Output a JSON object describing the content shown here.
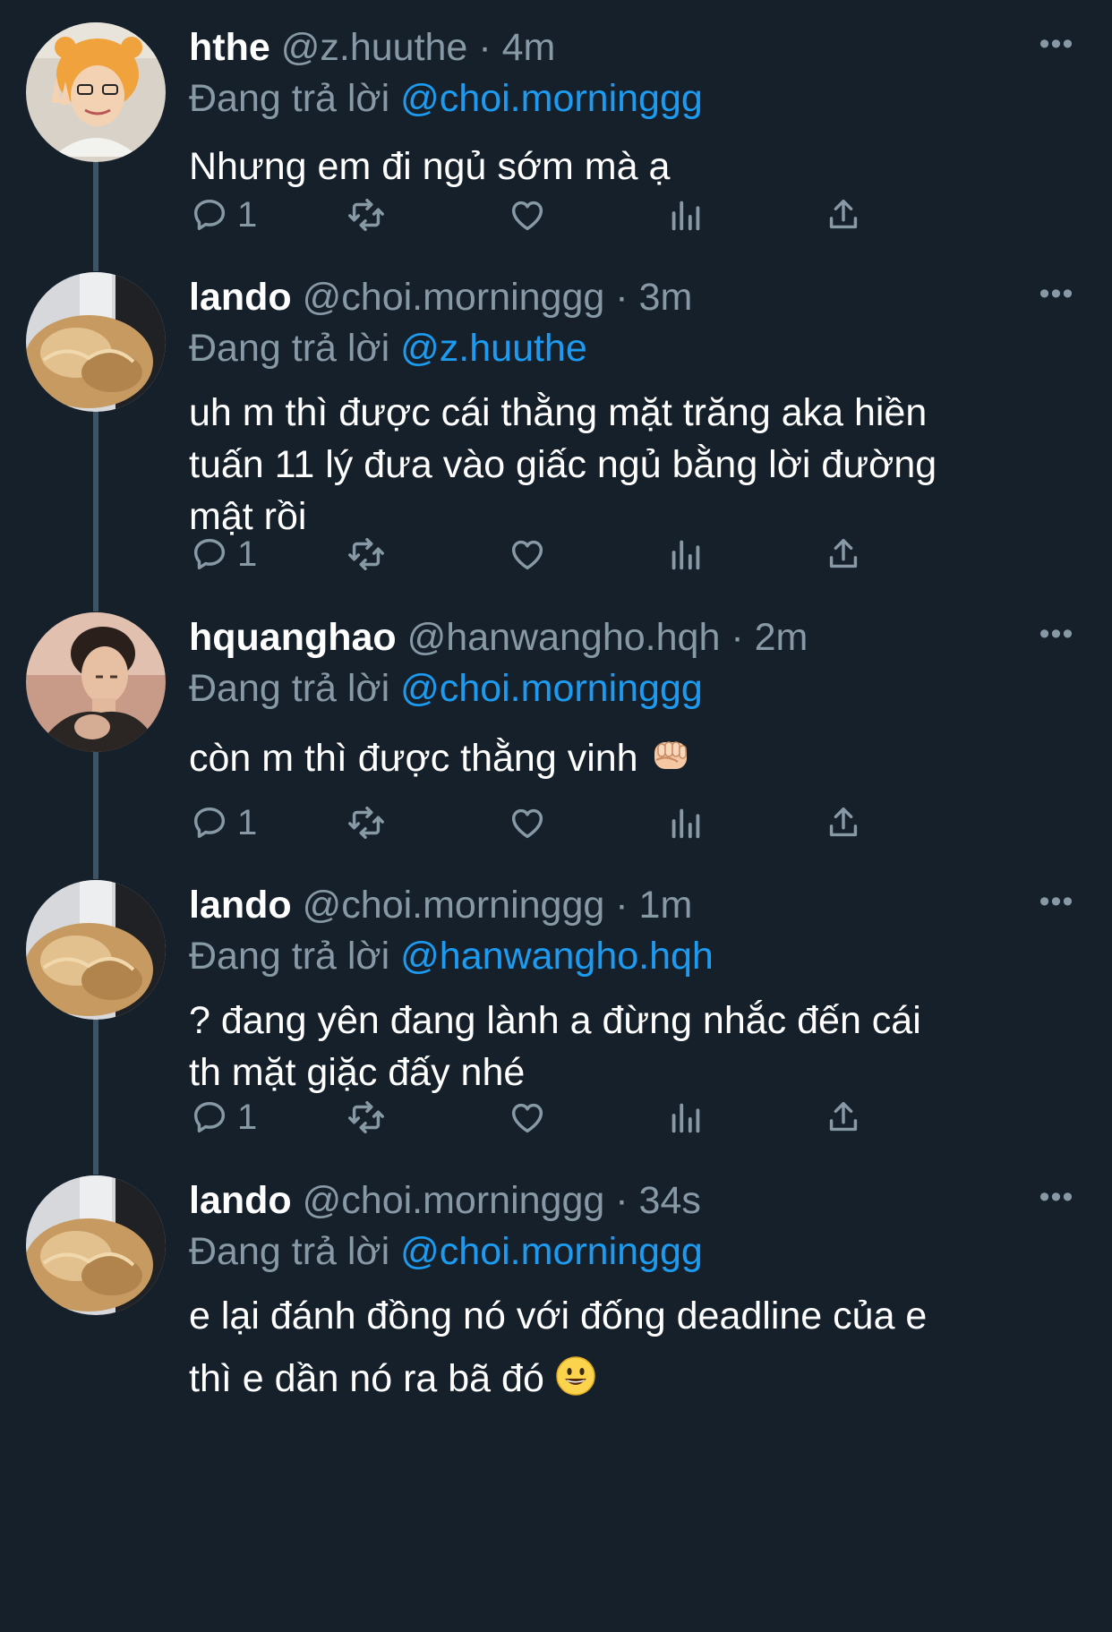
{
  "reply_prefix": "Đang trả lời",
  "tweets": [
    {
      "name": "hthe",
      "handle": "@z.huuthe",
      "sep": "·",
      "time": "4m",
      "replying_to": "@choi.morninggg",
      "text": "Nhưng em đi ngủ sớm mà ạ",
      "reply_count": "1",
      "avatar": "person-orange-hood-avatar"
    },
    {
      "name": "lando",
      "handle": "@choi.morninggg",
      "sep": "·",
      "time": "3m",
      "replying_to": "@z.huuthe",
      "text_lines": [
        "uh m thì được cái thằng mặt trăng aka hiền",
        "tuấn 11 lý đưa vào giấc ngủ bằng lời đường",
        "mật rồi"
      ],
      "reply_count": "1",
      "avatar": "blond-hair-avatar"
    },
    {
      "name": "hquanghao",
      "handle": "@hanwangho.hqh",
      "sep": "·",
      "time": "2m",
      "replying_to": "@choi.morninggg",
      "text": "còn m thì được thằng vinh",
      "emoji": "fist-emoji",
      "reply_count": "1",
      "avatar": "man-portrait-avatar"
    },
    {
      "name": "lando",
      "handle": "@choi.morninggg",
      "sep": "·",
      "time": "1m",
      "replying_to": "@hanwangho.hqh",
      "text_lines": [
        "? đang yên đang lành a đừng nhắc đến cái",
        "th mặt giặc đấy nhé"
      ],
      "reply_count": "1",
      "avatar": "blond-hair-avatar"
    },
    {
      "name": "lando",
      "handle": "@choi.morninggg",
      "sep": "·",
      "time": "34s",
      "replying_to": "@choi.morninggg",
      "text_lines": [
        "e lại đánh đồng nó với đống deadline của e",
        "thì e dần nó ra bã đó"
      ],
      "emoji": "grinning-face-emoji",
      "avatar": "blond-hair-avatar"
    }
  ],
  "more_label": "•••",
  "colors": {
    "background": "#15202b",
    "secondary_text": "#8899a6",
    "link": "#1d9bf0",
    "thread_line": "#3d5466"
  }
}
